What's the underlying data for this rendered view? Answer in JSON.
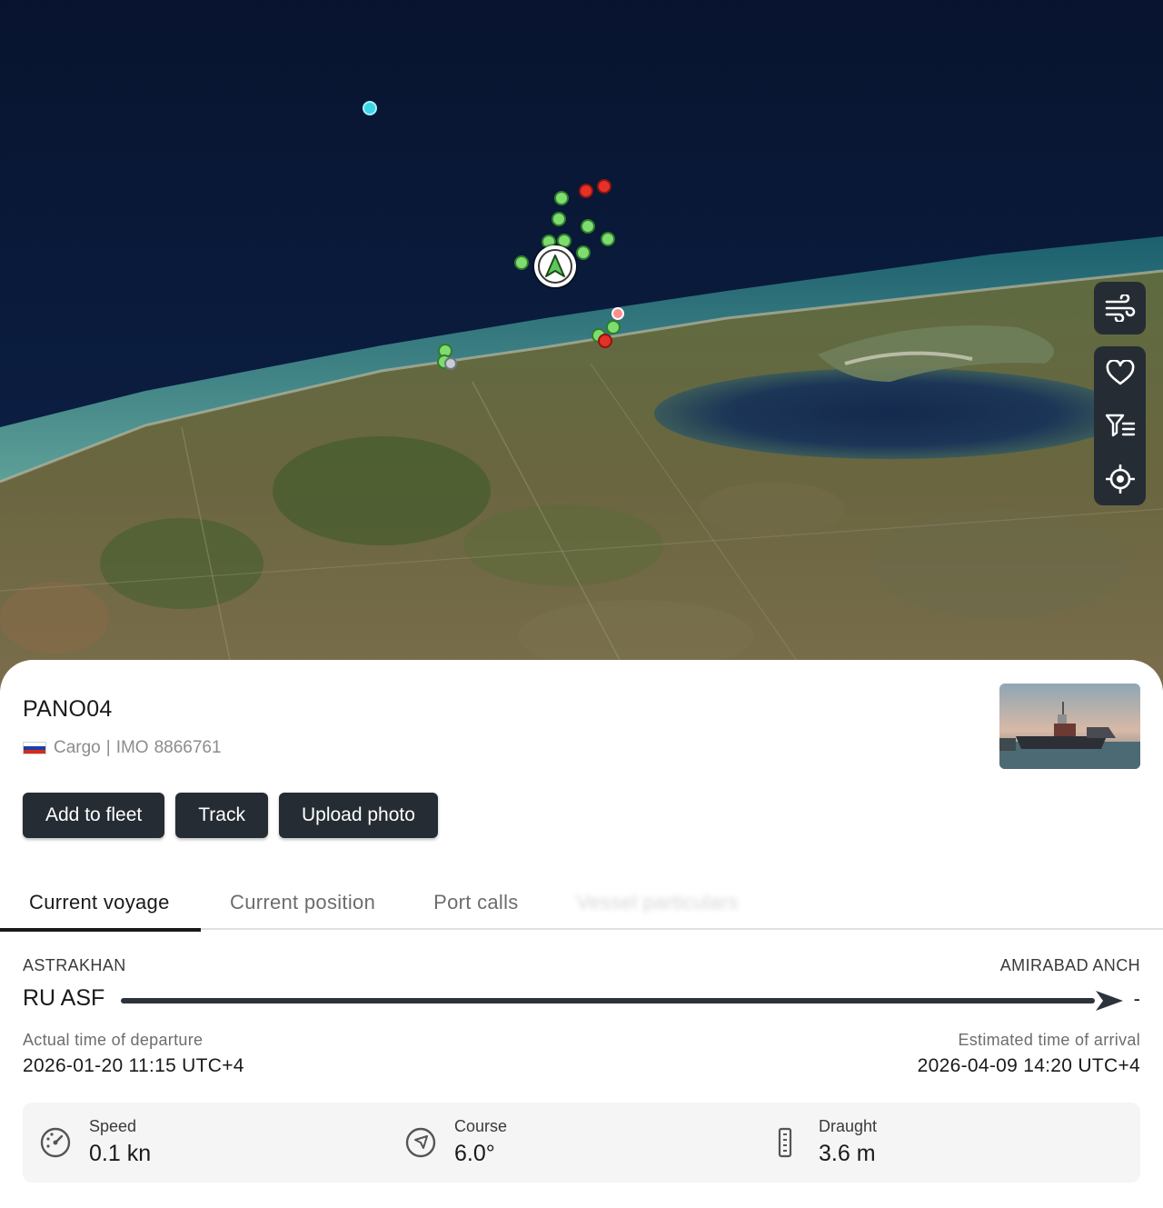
{
  "vessel": {
    "name": "PANO04",
    "flag_country": "Russia",
    "flag_colors": [
      "#ffffff",
      "#1c3fa8",
      "#d52b1e"
    ],
    "type": "Cargo",
    "separator": "|",
    "imo_label": "IMO",
    "imo_number": "8866761"
  },
  "actions": {
    "add_to_fleet": "Add to fleet",
    "track": "Track",
    "upload_photo": "Upload photo"
  },
  "tabs": [
    {
      "label": "Current voyage",
      "active": true
    },
    {
      "label": "Current position",
      "active": false
    },
    {
      "label": "Port calls",
      "active": false
    },
    {
      "label": "Vessel particulars",
      "active": false
    }
  ],
  "voyage": {
    "from_name": "ASTRAKHAN",
    "from_code": "RU ASF",
    "to_name": "AMIRABAD ANCH",
    "to_code": "-",
    "departure_label": "Actual time of departure",
    "departure_value": "2026-01-20 11:15 UTC+4",
    "arrival_label": "Estimated time of arrival",
    "arrival_value": "2026-04-09 14:20 UTC+4"
  },
  "stats": {
    "speed_label": "Speed",
    "speed_value": "0.1 kn",
    "course_label": "Course",
    "course_value": "6.0°",
    "draught_label": "Draught",
    "draught_value": "3.6 m"
  },
  "map_controls": [
    "wind-layer-icon",
    "heart-icon",
    "filter-list-icon",
    "locate-icon"
  ],
  "colors": {
    "sea": "#0b1a3a",
    "button": "#252c34",
    "marker_green": "#7fdc6f",
    "marker_red": "#e53127",
    "marker_cyan": "#3fd3e6"
  }
}
